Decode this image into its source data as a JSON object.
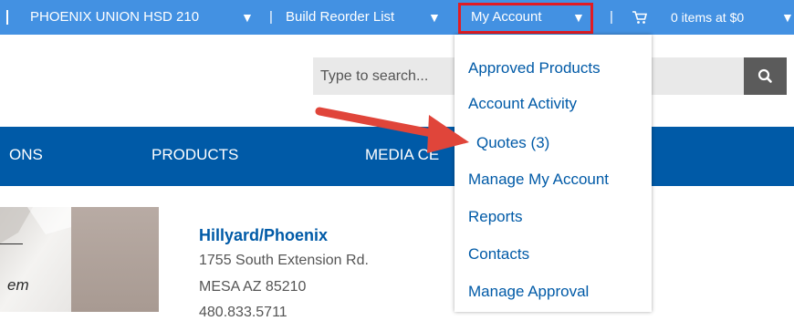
{
  "topbar": {
    "org_name": "PHOENIX UNION HSD 210",
    "separator": "|",
    "reorder_label": "Build Reorder List",
    "account_label": "My Account",
    "cart_separator": "|",
    "cart_label": "0 items at $0",
    "dropdown_arrow": "▼",
    "cart_icon": "shopping-cart-icon"
  },
  "search": {
    "placeholder": "Type to search...",
    "button_icon": "search-icon"
  },
  "nav": {
    "items": [
      {
        "label": "ONS"
      },
      {
        "label": "PRODUCTS"
      },
      {
        "label": "MEDIA CE"
      }
    ]
  },
  "image_text": "em",
  "address": {
    "name": "Hillyard/Phoenix",
    "street": "1755 South Extension Rd.",
    "city": "MESA AZ  85210",
    "phone": "480.833.5711"
  },
  "account_menu": {
    "items": [
      {
        "label": "Approved Products"
      },
      {
        "label": "Account Activity"
      },
      {
        "label": "Quotes (3)"
      },
      {
        "label": "Manage My Account"
      },
      {
        "label": "Reports"
      },
      {
        "label": "Contacts"
      },
      {
        "label": "Manage Approval"
      }
    ]
  },
  "colors": {
    "topbar": "#4391e2",
    "navbar": "#005aa7",
    "highlight_box": "#e21b22",
    "arrow": "#e0453a",
    "link": "#005aa7"
  }
}
